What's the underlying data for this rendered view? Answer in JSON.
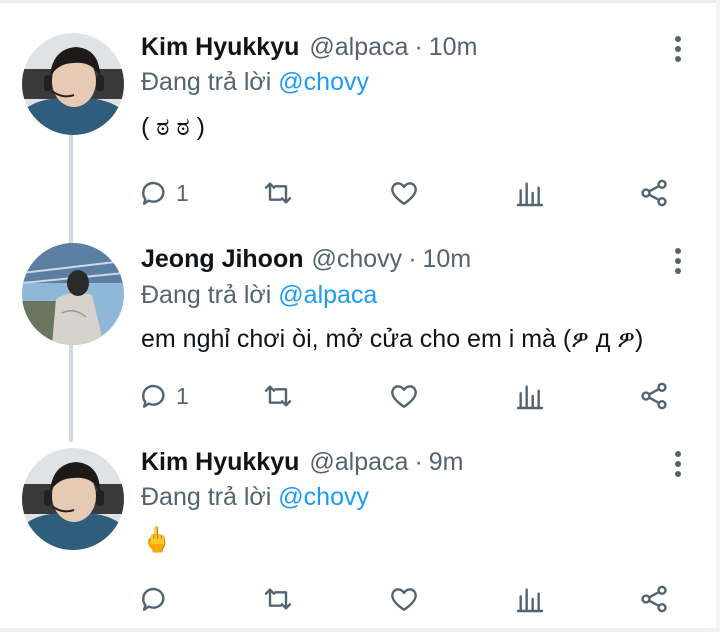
{
  "app": {
    "accent_color": "#1d9bf0",
    "text_color": "#0f1419",
    "muted_color": "#536471"
  },
  "tweets": [
    {
      "author": "Kim Hyukkyu",
      "handle": "@alpaca",
      "separator": "·",
      "time": "10m",
      "reply_prefix": "Đang trả lời ",
      "reply_to": "@chovy",
      "text": "( ಠ ಠ )",
      "reply_count": "1",
      "avatar_icon": "avatar-kim-hyukkyu"
    },
    {
      "author": "Jeong Jihoon",
      "handle": "@chovy",
      "separator": "·",
      "time": "10m",
      "reply_prefix": "Đang trả lời ",
      "reply_to": "@alpaca",
      "text": "em nghỉ chơi òi, mở cửa cho em i mà (ዎ д ዎ)",
      "reply_count": "1",
      "avatar_icon": "avatar-jeong-jihoon"
    },
    {
      "author": "Kim Hyukkyu",
      "handle": "@alpaca",
      "separator": "·",
      "time": "9m",
      "reply_prefix": "Đang trả lời ",
      "reply_to": "@chovy",
      "text": "🖕",
      "reply_count": "",
      "avatar_icon": "avatar-kim-hyukkyu"
    }
  ],
  "action_icons": [
    "reply-icon",
    "retweet-icon",
    "like-icon",
    "views-icon",
    "share-icon"
  ]
}
